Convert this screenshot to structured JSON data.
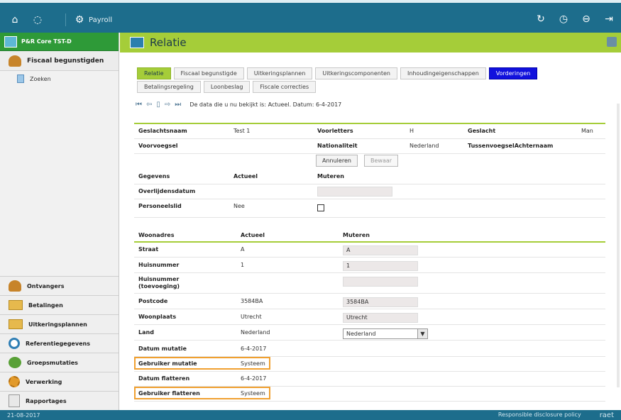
{
  "app": {
    "name": "Payroll",
    "environment": "P&R Core TST-D"
  },
  "sidebar": {
    "section": "Fiscaal begunstigden",
    "sub_item": "Zoeken",
    "modules": [
      "Ontvangers",
      "Betalingen",
      "Uitkeringsplannen",
      "Referentiegegevens",
      "Groepsmutaties",
      "Verwerking",
      "Rapportages"
    ]
  },
  "page": {
    "title": "Relatie"
  },
  "tabs": {
    "row1": [
      "Relatie",
      "Fiscaal begunstigde",
      "Uitkeringsplannen",
      "Uitkeringscomponenten",
      "Inhoudingeigenschappen",
      "Vorderingen"
    ],
    "row2": [
      "Betalingsregeling",
      "Loonbeslag",
      "Fiscale correcties"
    ]
  },
  "info_line": "De data die u nu bekijkt is: Actueel.  Datum: 6-4-2017",
  "person": {
    "geslachtsnaam_label": "Geslachtsnaam",
    "geslachtsnaam": "Test 1",
    "voorletters_label": "Voorletters",
    "voorletters": "H",
    "geslacht_label": "Geslacht",
    "geslacht": "Man",
    "voorvoegsel_label": "Voorvoegsel",
    "nationaliteit_label": "Nationaliteit",
    "nationaliteit": "Nederland",
    "tussenvoegsel_label": "TussenvoegselAchternaam"
  },
  "buttons": {
    "cancel": "Annuleren",
    "save": "Bewaar"
  },
  "gegevens": {
    "header": "Gegevens",
    "col_actueel": "Actueel",
    "col_muteren": "Muteren",
    "overlijdensdatum_label": "Overlijdensdatum",
    "personeelslid_label": "Personeelslid",
    "personeelslid": "Nee"
  },
  "woonadres": {
    "header": "Woonadres",
    "col_actueel": "Actueel",
    "col_muteren": "Muteren",
    "straat_label": "Straat",
    "straat": "A",
    "straat_input": "A",
    "huisnummer_label": "Huisnummer",
    "huisnummer": "1",
    "huisnummer_input": "1",
    "toevoeging_label1": "Huisnummer",
    "toevoeging_label2": "(toevoeging)",
    "postcode_label": "Postcode",
    "postcode": "3584BA",
    "postcode_input": "3584BA",
    "woonplaats_label": "Woonplaats",
    "woonplaats": "Utrecht",
    "woonplaats_input": "Utrecht",
    "land_label": "Land",
    "land": "Nederland",
    "land_select": "Nederland"
  },
  "mutaties": {
    "datum_mutatie_label": "Datum mutatie",
    "datum_mutatie": "6-4-2017",
    "gebruiker_mutatie_label": "Gebruiker mutatie",
    "gebruiker_mutatie": "Systeem",
    "datum_flatteren_label": "Datum flatteren",
    "datum_flatteren": "6-4-2017",
    "gebruiker_flatteren_label": "Gebruiker flatteren",
    "gebruiker_flatteren": "Systeem"
  },
  "footer": {
    "date": "21-08-2017",
    "link": "Responsible disclosure policy",
    "brand": "raet"
  }
}
